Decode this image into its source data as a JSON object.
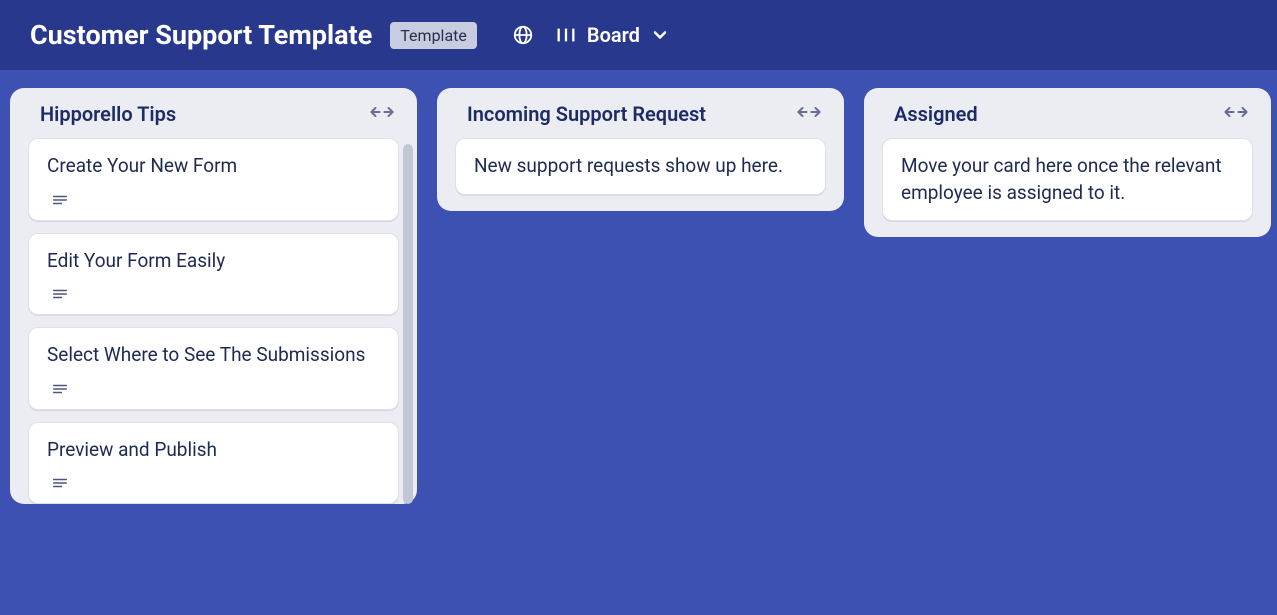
{
  "header": {
    "board_title": "Customer Support Template",
    "template_badge": "Template",
    "view_label": "Board"
  },
  "lists": [
    {
      "title": "Hipporello Tips",
      "show_scrollbar": true,
      "cards": [
        {
          "text": "Create Your New Form",
          "has_description": true
        },
        {
          "text": "Edit Your Form Easily",
          "has_description": true
        },
        {
          "text": "Select Where to See The Submissions",
          "has_description": true
        },
        {
          "text": "Preview and Publish",
          "has_description": true
        }
      ]
    },
    {
      "title": "Incoming Support Request",
      "show_scrollbar": false,
      "cards": [
        {
          "text": "New support requests show up here.",
          "has_description": false
        }
      ]
    },
    {
      "title": "Assigned",
      "show_scrollbar": false,
      "cards": [
        {
          "text": "Move your card here once the relevant employee is assigned to it.",
          "has_description": false
        }
      ]
    }
  ]
}
